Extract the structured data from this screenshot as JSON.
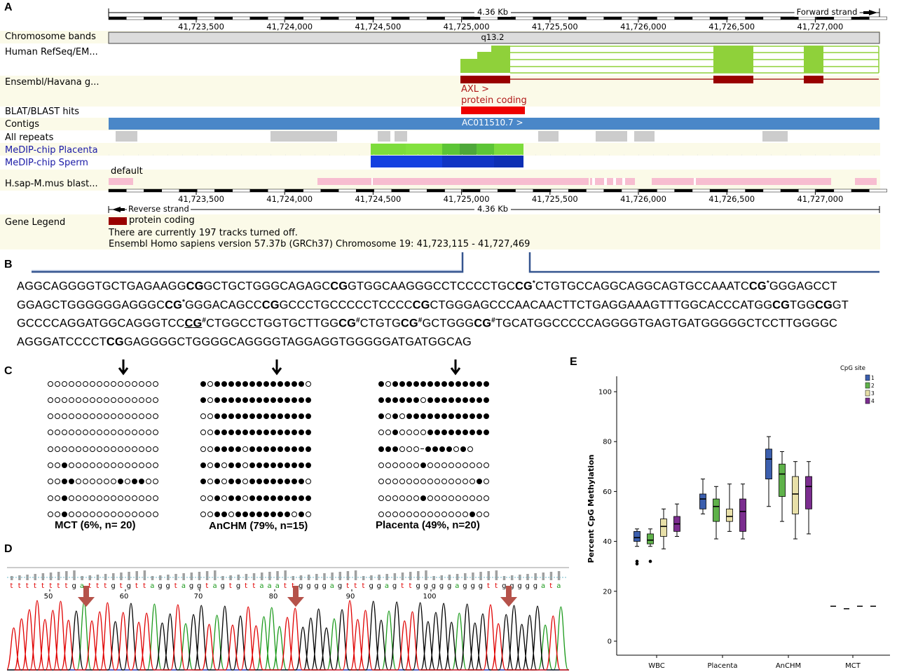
{
  "panels": {
    "a": "A",
    "b": "B",
    "c": "C",
    "d": "D",
    "e": "E"
  },
  "genome_browser": {
    "scale_label": "4.36 Kb",
    "forward_strand": "Forward strand",
    "reverse_strand": "Reverse strand",
    "coordinates": [
      "41,723,500",
      "41,724,000",
      "41,724,500",
      "41,725,000",
      "41,725,500",
      "41,726,000",
      "41,726,500",
      "41,727,000"
    ],
    "band_name": "q13.2",
    "contig_name": "AC011510.7 >",
    "gene_name": "AXL >",
    "gene_biotype": "protein coding",
    "default_label": "default",
    "tracks": {
      "chromosome_bands": "Chromosome bands",
      "refseq": "Human RefSeq/EM...",
      "ensembl": "Ensembl/Havana g...",
      "blat": "BLAT/BLAST hits",
      "contigs": "Contigs",
      "repeats": "All repeats",
      "medip_placenta": "MeDIP-chip Placenta",
      "medip_sperm": "MeDIP-chip Sperm",
      "hsap_mmus": "H.sap-M.mus blast...",
      "gene_legend": "Gene Legend"
    },
    "legend_item": "protein coding",
    "tracks_off": "There are currently 197 tracks turned off.",
    "ensembl_version": "Ensembl Homo sapiens version 57.37b (GRCh37) Chromosome 19: 41,723,115 - 41,727,469",
    "colors": {
      "refseq": "#8fd13a",
      "ensembl": "#990000",
      "gene_red": "#ee0000",
      "contig": "#4a87c8",
      "repeat": "#cccccc",
      "placenta": "#7ddc3c",
      "sperm": "#1440e0",
      "pink": "#f7bdd0"
    }
  },
  "sequence": {
    "lines": [
      [
        [
          "AGGCAGGGGTGCTGAGAAGG",
          ""
        ],
        [
          "CG",
          "b"
        ],
        [
          "GCTGCTGGGCAGAGC",
          ""
        ],
        [
          "CG",
          "b"
        ],
        [
          "GTGGCAAGGGCCTCCCCTGC",
          ""
        ],
        [
          "CG",
          "b"
        ],
        [
          "*",
          "sup"
        ],
        [
          "CTGTGCCAGGCAGGCAGTGCCAAATC",
          ""
        ],
        [
          "CG",
          "b"
        ],
        [
          "*",
          "sup"
        ],
        [
          "GGGAGCCT",
          ""
        ]
      ],
      [
        [
          "GGAGCTGGGGGGAGGGC",
          ""
        ],
        [
          "CG",
          "b"
        ],
        [
          "*",
          "sup"
        ],
        [
          "GGGACAGCC",
          ""
        ],
        [
          "CG",
          "b"
        ],
        [
          "GCCCTGCCCCCTCCCC",
          ""
        ],
        [
          "CG",
          "b"
        ],
        [
          "CTGGGAGCCCAACAACTTCTGAGGAAAGTTTGGCACCCATGG",
          ""
        ],
        [
          "CG",
          "b"
        ],
        [
          "TGG",
          ""
        ],
        [
          "CG",
          "b"
        ],
        [
          "GT",
          ""
        ]
      ],
      [
        [
          "GCCCCAGGATGGCAGGGTCC",
          ""
        ],
        [
          "CG",
          "bu"
        ],
        [
          "#",
          "sup"
        ],
        [
          "CTGGCCTGGTGCTTGG",
          ""
        ],
        [
          "CG",
          "b"
        ],
        [
          "#",
          "sup"
        ],
        [
          "CTGTG",
          ""
        ],
        [
          "CG",
          "b"
        ],
        [
          "#",
          "sup"
        ],
        [
          "GCTGGG",
          ""
        ],
        [
          "CG",
          "b"
        ],
        [
          "#",
          "sup"
        ],
        [
          "TGCATGGCCCCCAGGGGTGAGTGATGGGGGCTCCTTGGGGC",
          ""
        ]
      ],
      [
        [
          "AGGGATCCCCT",
          ""
        ],
        [
          "CG",
          "b"
        ],
        [
          "GAGGGGCTGGGGCAGGGGTAGGAGGTGGGGGATGATGGCAG",
          ""
        ]
      ]
    ]
  },
  "bisulfite": {
    "samples": [
      {
        "caption": "MCT (6%, n= 20)",
        "rows": [
          "oooooooooooooooo",
          "oooooooooooooooo",
          "oooooooooooooooo",
          "oooooooooooooooo",
          "oooooooooooooooo",
          "ooxooooooooooooo",
          "ooxxooooooxoxxoo",
          "ooxooooooooooooo",
          "ooxooooooooooooo"
        ]
      },
      {
        "caption": "AnCHM (79%, n=15)",
        "rows": [
          "xoxxxxxxxxxxxxxo",
          "xoxxxxxxxxxxxxxx",
          "ooxxxxxxxxxxxxxx",
          "ooxxxxxxxxxxxxxx",
          "ooxxxxoxxxxxxxxx",
          "xoxoxxoxxxxxxxxx",
          "xoxoxxoxxxxxxxxo",
          "ooxoxxoxxxxxxxxx",
          "ooxxoxxxxxxxxoxo"
        ]
      },
      {
        "caption": "Placenta (49%, n=20)",
        "rows": [
          "xoxxxxxxxxxxxxxx",
          "xxxxxxoxxxxxxxxx",
          "xoxoxxxxxxxxxxxx",
          "ooxooooxxxxxxxxx",
          "xxxooo-xxxxoxo",
          "ooooooxooooooooo",
          "ooooooooooooooxo",
          "ooooooxooooooooo",
          "oooooooooooooxoo"
        ]
      }
    ]
  },
  "chromatogram": {
    "bases": "ttttttttgatttgtgttaggtaggtagtgttaaattggggagtttggagttgggggagggttgggggata",
    "positions": [
      "50",
      "60",
      "70",
      "80",
      "90",
      "100"
    ]
  },
  "chart_data": {
    "type": "box",
    "title": "",
    "xlabel": "",
    "ylabel": "Percent CpG Methylation",
    "ylim": [
      0,
      100
    ],
    "yticks": [
      0,
      20,
      40,
      60,
      80,
      100
    ],
    "categories": [
      "WBC",
      "Placenta",
      "AnCHM",
      "MCT"
    ],
    "legend_title": "CpG site",
    "legend_position": "top-right",
    "series": [
      {
        "name": "1",
        "color": "#3c5fae",
        "boxes": [
          {
            "min": 38,
            "q1": 40,
            "median": 41.5,
            "q3": 44,
            "max": 45,
            "outliers": [
              31,
              32
            ]
          },
          {
            "min": 51,
            "q1": 53,
            "median": 57,
            "q3": 59,
            "max": 65,
            "outliers": []
          },
          {
            "min": 54,
            "q1": 65,
            "median": 73,
            "q3": 77,
            "max": 82,
            "outliers": []
          },
          {
            "min": 14,
            "q1": 14,
            "median": 14,
            "q3": 14,
            "max": 14,
            "outliers": []
          }
        ]
      },
      {
        "name": "2",
        "color": "#5fb24a",
        "boxes": [
          {
            "min": 38,
            "q1": 39,
            "median": 40.5,
            "q3": 43,
            "max": 45,
            "outliers": [
              32
            ]
          },
          {
            "min": 41,
            "q1": 48,
            "median": 54,
            "q3": 57,
            "max": 62,
            "outliers": []
          },
          {
            "min": 48,
            "q1": 58,
            "median": 67,
            "q3": 71,
            "max": 76,
            "outliers": []
          },
          {
            "min": 13,
            "q1": 13,
            "median": 13,
            "q3": 13,
            "max": 13,
            "outliers": []
          }
        ]
      },
      {
        "name": "3",
        "color": "#e8e0a8",
        "boxes": [
          {
            "min": 37,
            "q1": 42,
            "median": 46,
            "q3": 49,
            "max": 53,
            "outliers": []
          },
          {
            "min": 44,
            "q1": 48,
            "median": 50,
            "q3": 53,
            "max": 63,
            "outliers": []
          },
          {
            "min": 41,
            "q1": 51,
            "median": 59,
            "q3": 66,
            "max": 72,
            "outliers": []
          },
          {
            "min": 14,
            "q1": 14,
            "median": 14,
            "q3": 14,
            "max": 14,
            "outliers": []
          }
        ]
      },
      {
        "name": "4",
        "color": "#7b2d8f",
        "boxes": [
          {
            "min": 42,
            "q1": 44,
            "median": 47,
            "q3": 50,
            "max": 55,
            "outliers": []
          },
          {
            "min": 41,
            "q1": 44,
            "median": 52,
            "q3": 57,
            "max": 63,
            "outliers": []
          },
          {
            "min": 43,
            "q1": 53,
            "median": 62,
            "q3": 66,
            "max": 72,
            "outliers": []
          },
          {
            "min": 14,
            "q1": 14,
            "median": 14,
            "q3": 14,
            "max": 14,
            "outliers": []
          }
        ]
      }
    ]
  }
}
